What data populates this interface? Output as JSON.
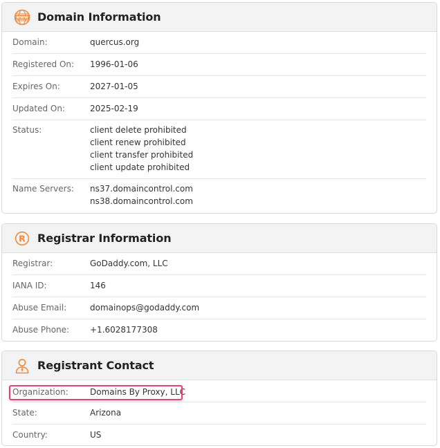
{
  "accent_color": "#f08a3c",
  "highlight_color": "#e0427a",
  "domain_info": {
    "title": "Domain Information",
    "icon": "www-globe-icon",
    "domain_label": "Domain:",
    "domain_value": "quercus.org",
    "registered_label": "Registered On:",
    "registered_value": "1996-01-06",
    "expires_label": "Expires On:",
    "expires_value": "2027-01-05",
    "updated_label": "Updated On:",
    "updated_value": "2025-02-19",
    "status_label": "Status:",
    "status_values": [
      "client delete prohibited",
      "client renew prohibited",
      "client transfer prohibited",
      "client update prohibited"
    ],
    "ns_label": "Name Servers:",
    "ns_values": [
      "ns37.domaincontrol.com",
      "ns38.domaincontrol.com"
    ]
  },
  "registrar_info": {
    "title": "Registrar Information",
    "icon": "registered-icon",
    "registrar_label": "Registrar:",
    "registrar_value": "GoDaddy.com, LLC",
    "iana_label": "IANA ID:",
    "iana_value": "146",
    "abuse_email_label": "Abuse Email:",
    "abuse_email_value": "domainops@godaddy.com",
    "abuse_phone_label": "Abuse Phone:",
    "abuse_phone_value": "+1.6028177308"
  },
  "registrant_contact": {
    "title": "Registrant Contact",
    "icon": "person-icon",
    "org_label": "Organization:",
    "org_value": "Domains By Proxy, LLC",
    "state_label": "State:",
    "state_value": "Arizona",
    "country_label": "Country:",
    "country_value": "US"
  }
}
